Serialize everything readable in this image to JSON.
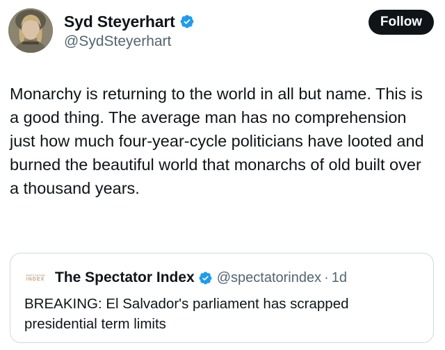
{
  "author": {
    "display_name": "Syd Steyerhart",
    "handle": "@SydSteyerhart",
    "verified_icon": "verified-badge-icon",
    "avatar": "profile-photo"
  },
  "follow_button": {
    "label": "Follow"
  },
  "tweet": {
    "text": "Monarchy is returning to the world in all but name. This is a good thing. The average man has no comprehension just how much four-year-cycle politicians have looted and burned the beautiful world that monarchs of old built over a thousand years."
  },
  "quoted_tweet": {
    "logo_line1": "SPECTATOR",
    "logo_line2": "INDEX",
    "display_name": "The Spectator Index",
    "handle": "@spectatorindex",
    "separator": "·",
    "time": "1d",
    "text": "BREAKING: El Salvador's parliament has scrapped presidential term limits"
  },
  "colors": {
    "text_primary": "#0f1419",
    "text_secondary": "#536471",
    "verified_blue": "#1d9bf0",
    "follow_bg": "#0f1419",
    "card_border": "#cfd9de"
  }
}
